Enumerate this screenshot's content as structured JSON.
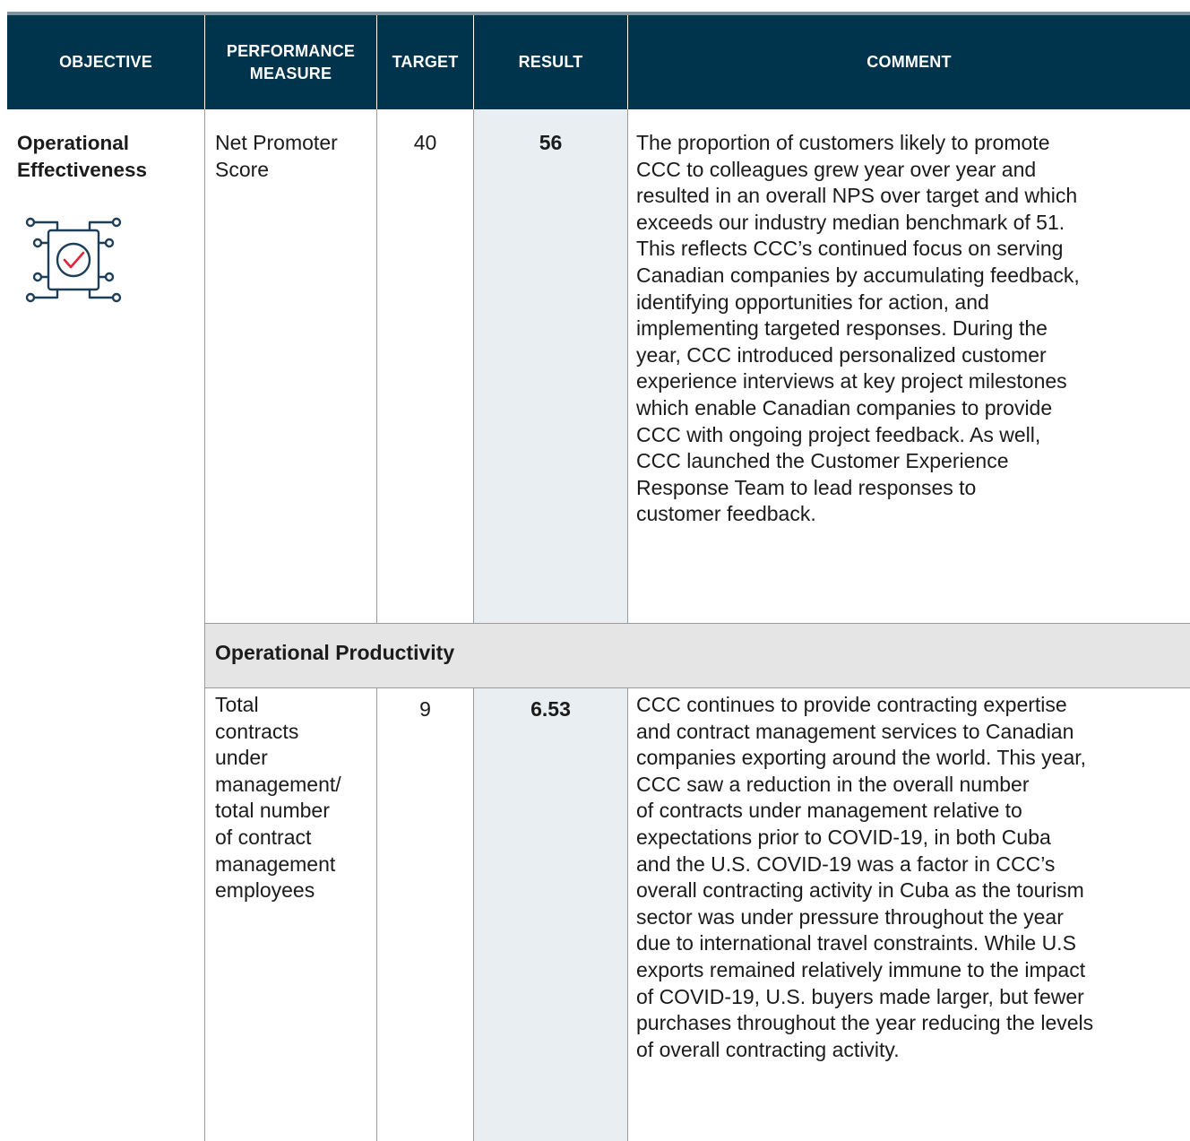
{
  "header": {
    "objective": "OBJECTIVE",
    "performance_measure_line1": "PERFORMANCE",
    "performance_measure_line2": "MEASURE",
    "target": "TARGET",
    "result": "RESULT",
    "comment": "COMMENT"
  },
  "rows": [
    {
      "objective_line1": "Operational",
      "objective_line2": "Effectiveness",
      "objective_icon": "process-check-icon",
      "measure_lines": [
        "Net Promoter",
        "Score"
      ],
      "target": "40",
      "result": "56",
      "comment_lines": [
        "The proportion of customers likely to promote",
        "CCC to colleagues grew year over year and",
        "resulted in an overall NPS over target and which",
        "exceeds our industry median benchmark of 51.",
        "This reflects CCC’s continued focus on serving",
        "Canadian companies by accumulating feedback,",
        "identifying opportunities for action, and",
        "implementing targeted responses. During the",
        "year, CCC introduced personalized customer",
        "experience interviews at key project milestones",
        "which enable Canadian companies to provide",
        "CCC with ongoing project feedback. As well,",
        "CCC launched the Customer Experience",
        "Response Team to lead responses to",
        "customer feedback."
      ]
    },
    {
      "section_title": "Operational Productivity"
    },
    {
      "measure_lines": [
        "Total",
        "contracts",
        "under",
        "management/",
        "total number",
        "of contract",
        "management",
        "employees"
      ],
      "target": "9",
      "result": "6.53",
      "comment_lines": [
        "CCC continues to provide contracting expertise",
        "and contract management services to Canadian",
        "companies exporting around the world. This year,",
        "CCC saw a reduction in the overall number",
        "of contracts under management relative to",
        "expectations prior to COVID-19, in both Cuba",
        "and the U.S. COVID-19 was a factor in CCC’s",
        "overall contracting activity in Cuba as the tourism",
        "sector was under pressure throughout the year",
        "due to international travel constraints. While U.S",
        "exports remained relatively immune to the impact",
        "of COVID-19, U.S. buyers made larger, but fewer",
        "purchases throughout the year reducing the levels",
        "of overall contracting activity."
      ]
    }
  ],
  "colors": {
    "header_bg": "#00334c",
    "result_column_bg": "#e9eef2",
    "section_band_bg": "#e5e5e5",
    "icon_navy": "#1d3e59",
    "icon_check_red": "#e0253b"
  }
}
